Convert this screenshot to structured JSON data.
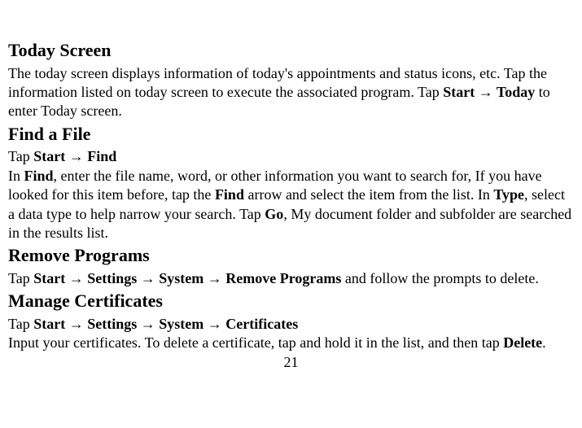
{
  "sections": {
    "today": {
      "heading": "Today Screen",
      "p1a": "The today screen displays information of today's appointments and status icons, etc. Tap the information listed on today screen to execute the associated program. Tap ",
      "p1_start": "Start ",
      "p1_arrow": "→",
      "p1_today": " Today",
      "p1b": " to enter Today screen."
    },
    "find": {
      "heading": "Find a File",
      "tap": "Tap ",
      "start": "Start ",
      "arrow": "→",
      "find": " Find",
      "p2a": "In ",
      "p2_find": "Find",
      "p2b": ", enter the file name, word, or other information you want to search for, If you have looked for this item before, tap the ",
      "p2_find2": "Find",
      "p2c": " arrow and select the item from the list. In ",
      "p2_type": "Type",
      "p2d": ", select a data type to help narrow your search. Tap ",
      "p2_go": "Go",
      "p2e": ", My document folder and subfolder are searched in the results list."
    },
    "remove": {
      "heading": "Remove Programs",
      "tap": "Tap ",
      "start": "Start ",
      "a1": "→",
      "settings": " Settings ",
      "a2": "→",
      "system": " System ",
      "a3": "→",
      "rp": " Remove Programs",
      "rest": " and follow the prompts to delete."
    },
    "manage": {
      "heading": "Manage Certificates",
      "tap": "Tap ",
      "start": "Start ",
      "a1": "→",
      "settings": " Settings ",
      "a2": "→",
      "system": " System ",
      "a3": "→",
      "cert": " Certificates",
      "p2a": "Input your certificates. To delete a certificate, tap and hold it in the list, and then tap ",
      "p2_delete": "Delete",
      "p2b": "."
    }
  },
  "pagenum": "21"
}
